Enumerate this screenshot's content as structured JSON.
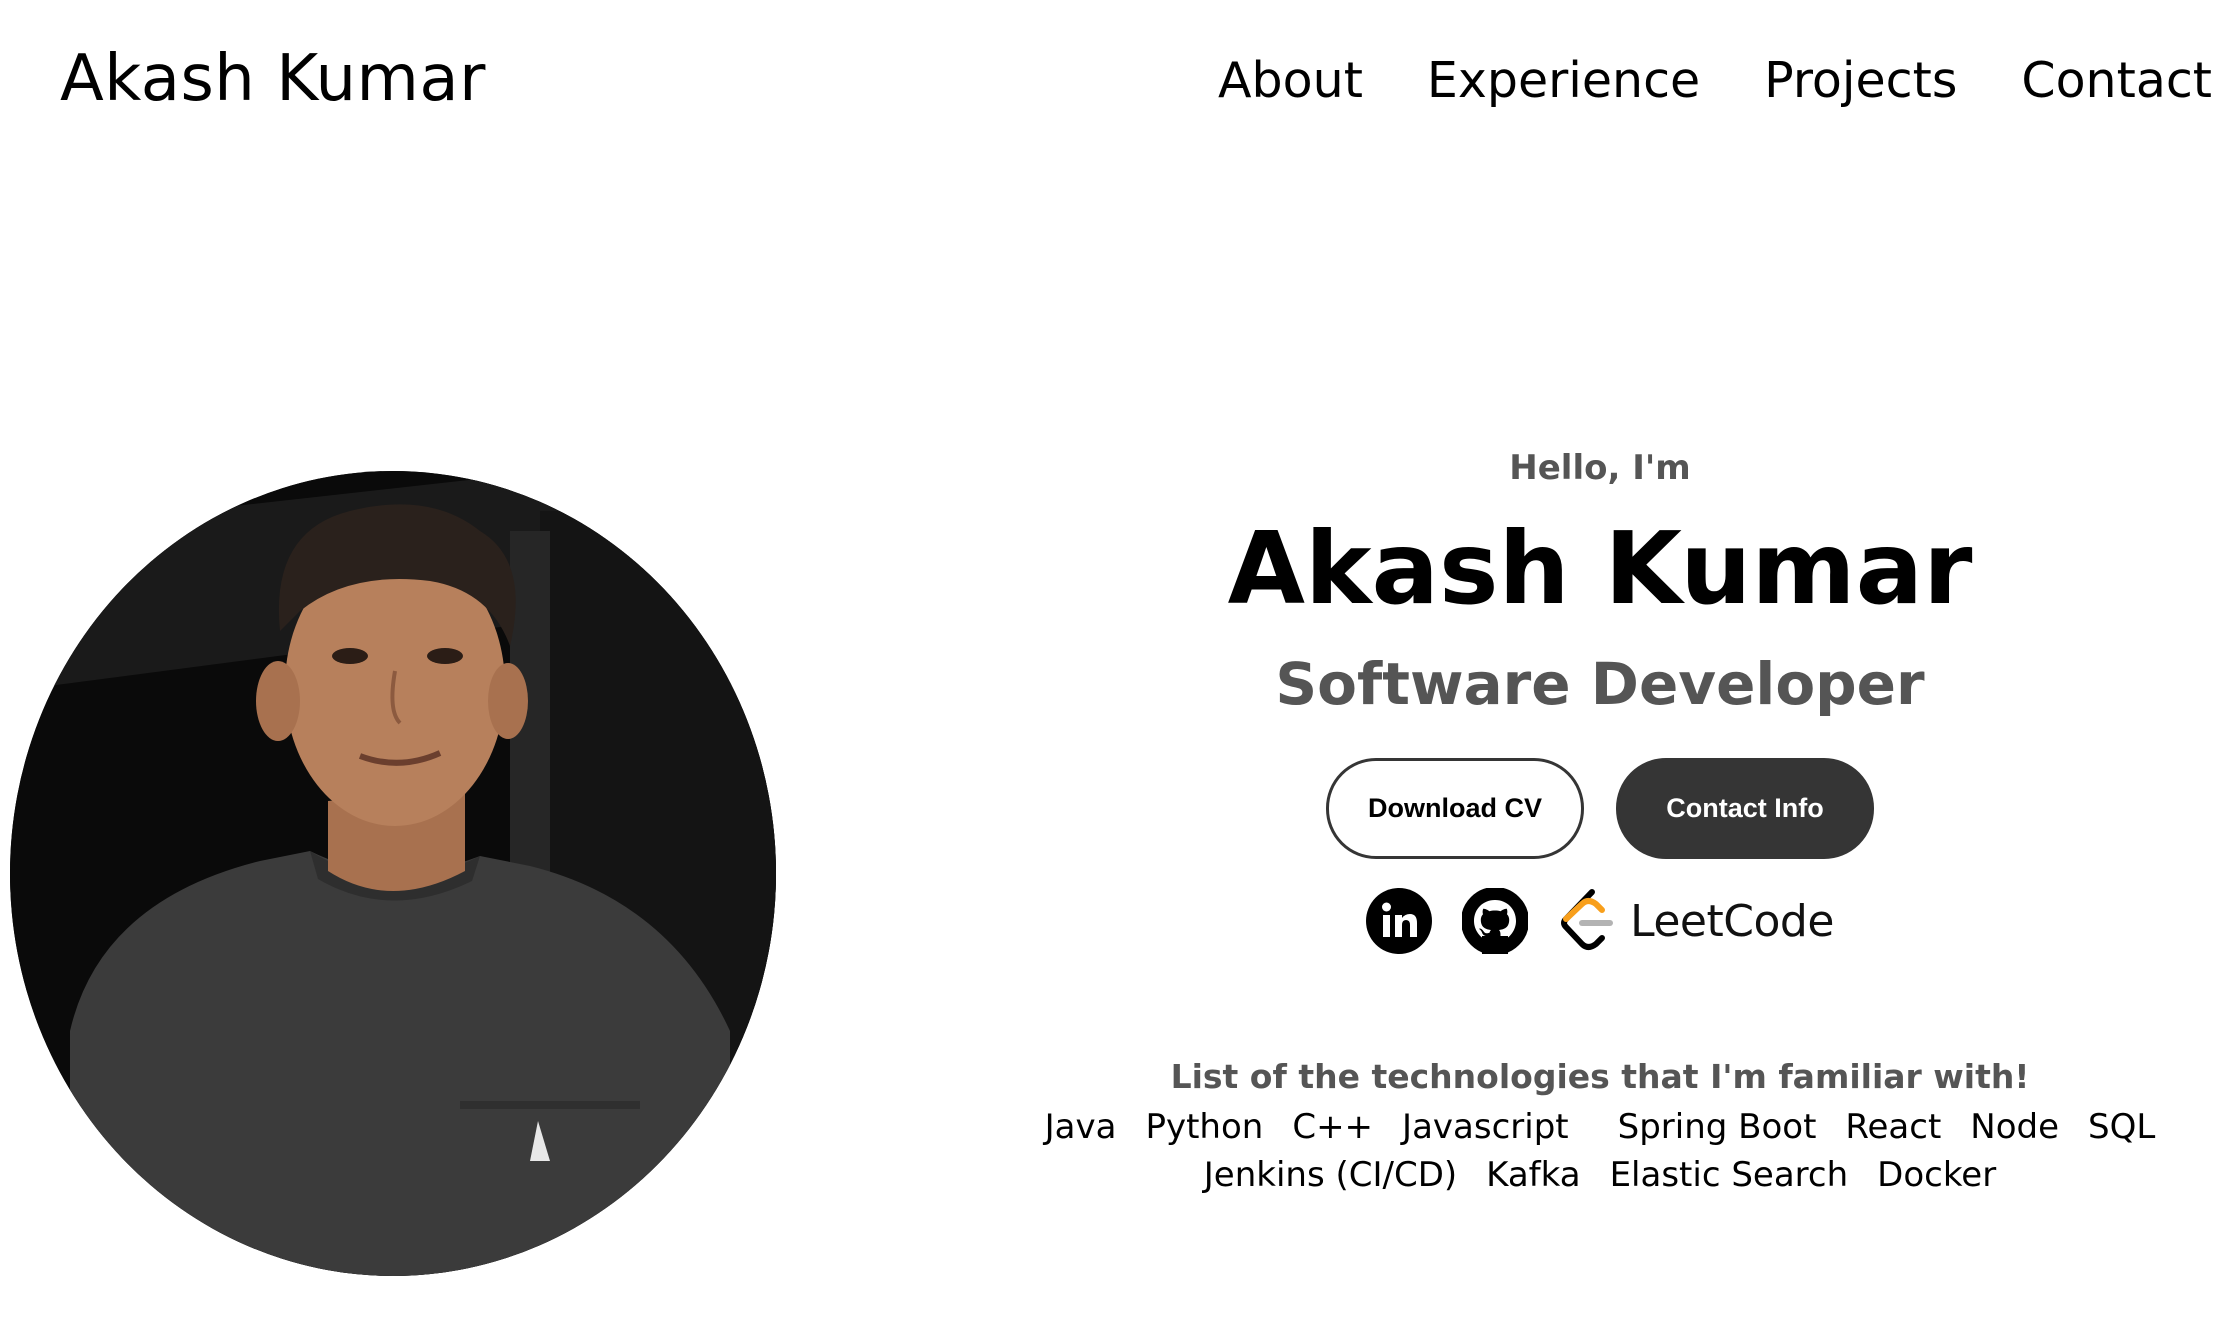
{
  "header": {
    "logo": "Akash Kumar",
    "nav": [
      "About",
      "Experience",
      "Projects",
      "Contact"
    ]
  },
  "hero": {
    "greeting": "Hello, I'm",
    "name": "Akash Kumar",
    "role": "Software Developer",
    "buttons": {
      "download_cv": "Download CV",
      "contact_info": "Contact Info"
    },
    "socials": {
      "linkedin_icon": "linkedin-icon",
      "github_icon": "github-icon",
      "leetcode_label": "LeetCode"
    },
    "photo_alt": "profile-photo"
  },
  "technologies": {
    "title": "List of the technologies that I'm familiar with!",
    "row1": [
      "Java",
      "Python",
      "C++",
      "Javascript",
      "Spring Boot",
      "React",
      "Node",
      "SQL"
    ],
    "row2": [
      "Jenkins (CI/CD)",
      "Kafka",
      "Elastic Search",
      "Docker"
    ]
  },
  "colors": {
    "text": "#000000",
    "muted": "#555555",
    "button_dark": "#353535",
    "leetcode_orange": "#f89f1b",
    "leetcode_gray": "#b3b3b3"
  }
}
